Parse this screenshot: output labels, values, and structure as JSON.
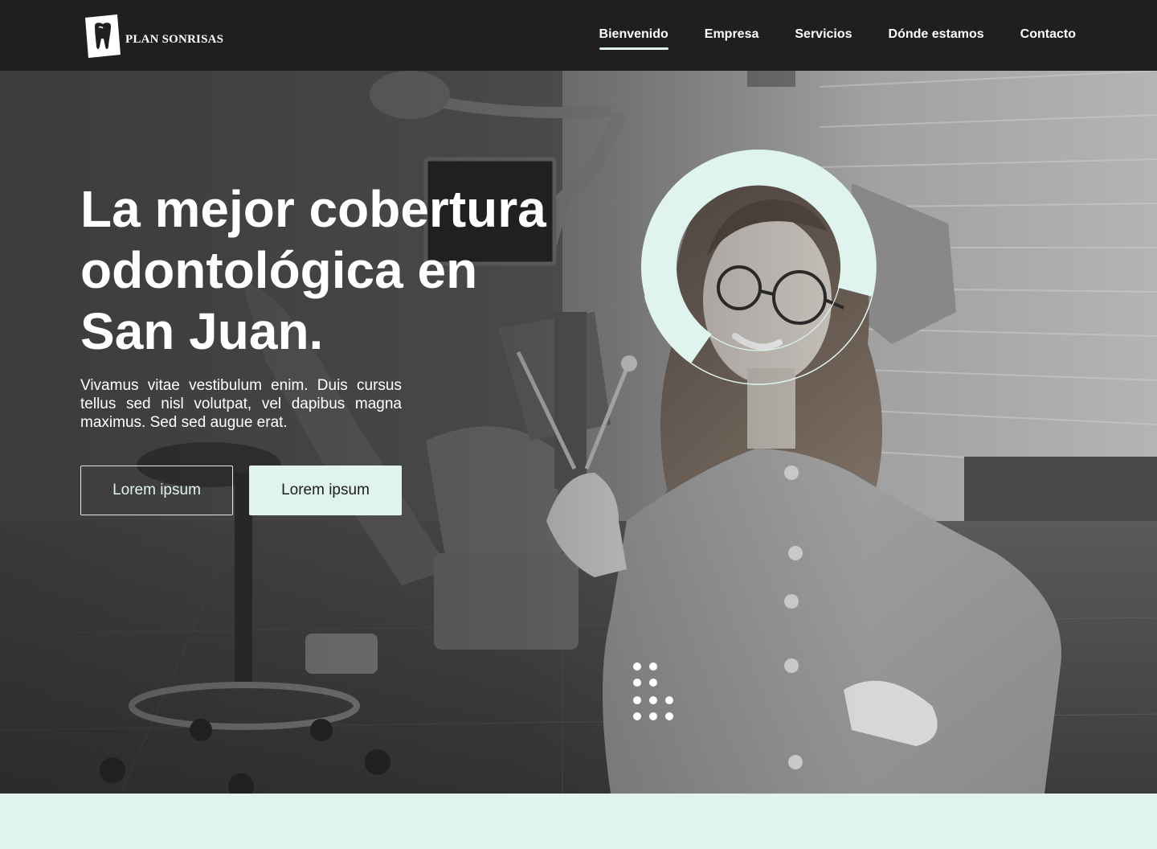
{
  "brand": {
    "name": "PLAN SONRISAS",
    "logo_icon": "tooth-logo-icon"
  },
  "nav": {
    "items": [
      {
        "label": "Bienvenido",
        "active": true
      },
      {
        "label": "Empresa",
        "active": false
      },
      {
        "label": "Servicios",
        "active": false
      },
      {
        "label": "Dónde estamos",
        "active": false
      },
      {
        "label": "Contacto",
        "active": false
      }
    ]
  },
  "hero": {
    "title": "La mejor cobertura\nodontológica en\nSan Juan.",
    "text": "Vivamus vitae vestibulum enim. Duis cursus tellus sed nisl volutpat, vel dapibus magna maximus. Sed sed augue erat.",
    "primary_button": "Lorem ipsum",
    "secondary_button": "Lorem ipsum"
  },
  "colors": {
    "accent": "#dff3ef",
    "navbar": "#1f1f1f",
    "text_light": "#ffffff"
  }
}
